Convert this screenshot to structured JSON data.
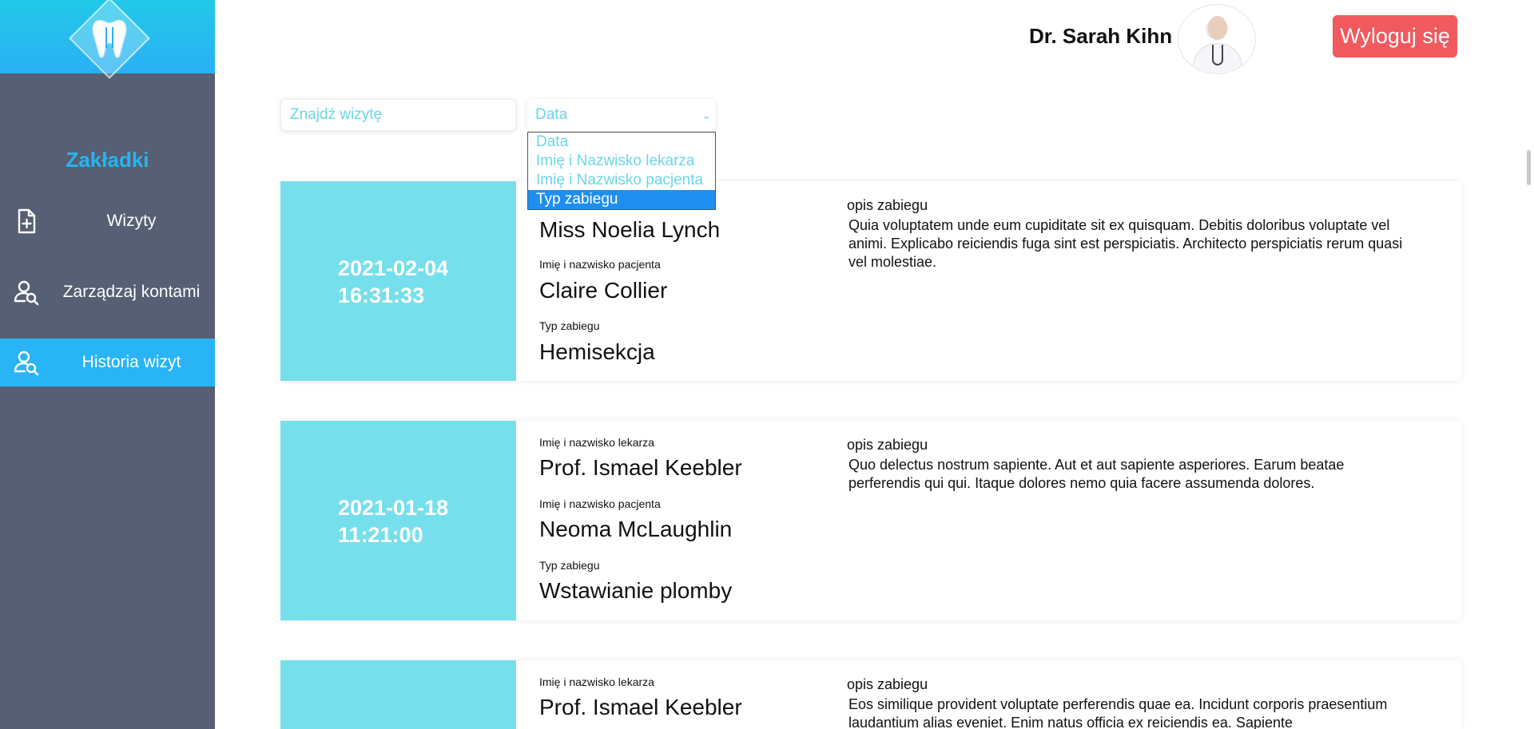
{
  "sidebar": {
    "title": "Zakładki",
    "items": [
      {
        "label": "Wizyty"
      },
      {
        "label": "Zarządzaj kontami"
      },
      {
        "label": "Historia wizyt"
      }
    ]
  },
  "header": {
    "doctor_name": "Dr. Sarah Kihn",
    "logout_label": "Wyloguj się"
  },
  "search": {
    "placeholder": "Znajdź wizytę"
  },
  "sort": {
    "selected": "Data",
    "options": [
      "Data",
      "Imię i Nazwisko lekarza",
      "Imię i Nazwisko pacjenta",
      "Typ zabiegu"
    ],
    "highlighted_option": "Typ zabiegu"
  },
  "labels": {
    "doctor": "Imię i nazwisko lekarza",
    "patient": "Imię i nazwisko pacjenta",
    "type": "Typ zabiegu",
    "description": "opis zabiegu"
  },
  "visits": [
    {
      "date": "2021-02-04",
      "time": "16:31:33",
      "doctor": "Miss Noelia Lynch",
      "patient": "Claire Collier",
      "type": "Hemisekcja",
      "description": "Quia voluptatem unde eum cupiditate sit ex quisquam. Debitis doloribus voluptate vel animi. Explicabo reiciendis fuga sint est perspiciatis. Architecto perspiciatis rerum quasi vel molestiae."
    },
    {
      "date": "2021-01-18",
      "time": "11:21:00",
      "doctor": "Prof. Ismael Keebler",
      "patient": "Neoma McLaughlin",
      "type": "Wstawianie plomby",
      "description": "Quo delectus nostrum sapiente. Aut et aut sapiente asperiores. Earum beatae perferendis qui qui. Itaque dolores nemo quia facere assumenda dolores."
    },
    {
      "doctor": "Prof. Ismael Keebler",
      "description": "Eos similique provident voluptate perferendis quae ea. Incidunt corporis praesentium laudantium alias eveniet. Enim natus officia ex reiciendis ea. Sapiente"
    }
  ],
  "colors": {
    "sidebar_bg": "#565f73",
    "accent": "#29b4f5",
    "date_block": "#76dfec",
    "logout": "#f05a5e"
  }
}
